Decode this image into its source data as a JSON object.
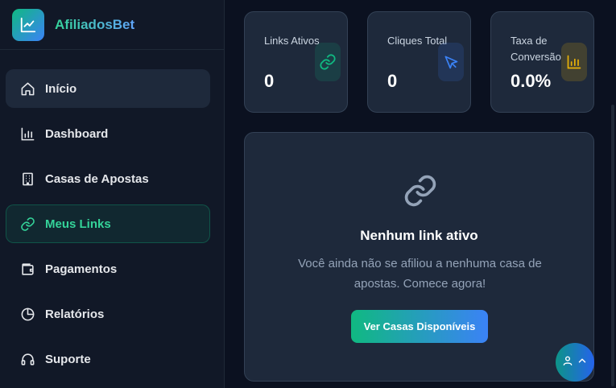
{
  "brand": {
    "name": "AfiliadosBet",
    "logo_icon": "trend-chart-icon"
  },
  "sidebar": {
    "items": [
      {
        "label": "Início",
        "icon": "home-icon",
        "state": "hover"
      },
      {
        "label": "Dashboard",
        "icon": "bar-chart-icon",
        "state": ""
      },
      {
        "label": "Casas de Apostas",
        "icon": "building-icon",
        "state": ""
      },
      {
        "label": "Meus Links",
        "icon": "link-icon",
        "state": "active"
      },
      {
        "label": "Pagamentos",
        "icon": "wallet-icon",
        "state": ""
      },
      {
        "label": "Relatórios",
        "icon": "pie-chart-icon",
        "state": ""
      },
      {
        "label": "Suporte",
        "icon": "headphones-icon",
        "state": ""
      }
    ]
  },
  "stats": [
    {
      "label": "Links Ativos",
      "value": "0",
      "icon": "link-icon",
      "color": "#10b981"
    },
    {
      "label": "Cliques Total",
      "value": "0",
      "icon": "cursor-icon",
      "color": "#3b82f6"
    },
    {
      "label": "Taxa de Conversão",
      "value": "0.0%",
      "icon": "bar-chart-icon",
      "color": "#eab308"
    }
  ],
  "empty_state": {
    "icon": "link-icon",
    "title": "Nenhum link ativo",
    "message": "Você ainda não se afiliou a nenhuma casa de apostas. Comece agora!",
    "cta_label": "Ver Casas Disponíveis"
  },
  "colors": {
    "accent_green": "#10b981",
    "accent_blue": "#3b82f6",
    "background": "#0b1120",
    "card": "#1e293b"
  }
}
